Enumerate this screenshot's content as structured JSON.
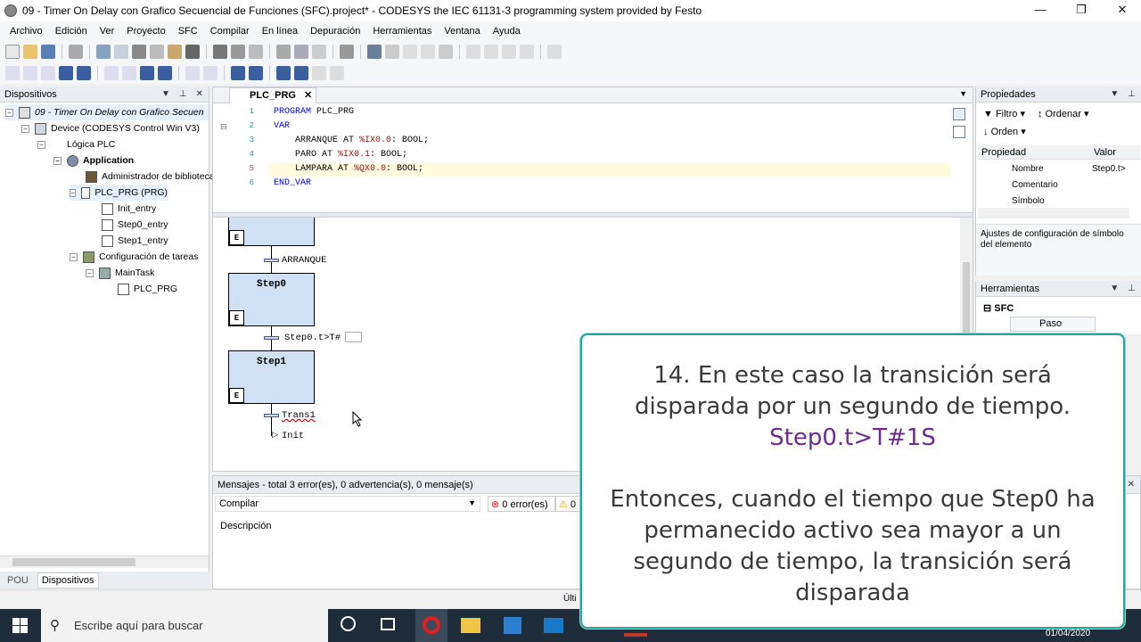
{
  "window": {
    "title": "09 - Timer On Delay con Grafico Secuencial de Funciones (SFC).project* - CODESYS the IEC 61131-3 programming system provided by Festo",
    "minimize": "—",
    "maximize": "❐",
    "close": "✕"
  },
  "menu": [
    "Archivo",
    "Edición",
    "Ver",
    "Proyecto",
    "SFC",
    "Compilar",
    "En línea",
    "Depuración",
    "Herramientas",
    "Ventana",
    "Ayuda"
  ],
  "devices_panel": {
    "title": "Dispositivos",
    "tree": [
      {
        "label": "09 - Timer On Delay con Grafico Secuen"
      },
      {
        "label": "Device (CODESYS Control Win V3)"
      },
      {
        "label": "Lógica PLC"
      },
      {
        "label": "Application"
      },
      {
        "label": "Administrador de biblioteca"
      },
      {
        "label": "PLC_PRG (PRG)"
      },
      {
        "label": "Init_entry"
      },
      {
        "label": "Step0_entry"
      },
      {
        "label": "Step1_entry"
      },
      {
        "label": "Configuración de tareas"
      },
      {
        "label": "MainTask"
      },
      {
        "label": "PLC_PRG"
      }
    ],
    "bottom_tabs": [
      "POU",
      "Dispositivos"
    ]
  },
  "editor": {
    "tab_label": "PLC_PRG",
    "line_numbers": [
      "1",
      "2",
      "3",
      "4",
      "5",
      "6"
    ],
    "code": {
      "l1_kw": "PROGRAM",
      "l1_rest": " PLC_PRG",
      "l2_kw": "VAR",
      "l3_name": "    ARRANQUE AT ",
      "l3_addr": "%IX0.0",
      "l3_type": ": BOOL;",
      "l4_name": "    PARO AT ",
      "l4_addr": "%IX0.1",
      "l4_type": ": BOOL;",
      "l5_name": "    LAMPARA AT ",
      "l5_addr": "%QX0.0",
      "l5_type": ": BOOL;",
      "l6_kw": "END_VAR"
    },
    "sfc": {
      "step_e": "E",
      "transition_1": "ARRANQUE",
      "step0": "Step0",
      "transition_2": "Step0.t>T#",
      "step1": "Step1",
      "transition_3": "Trans1",
      "jump": "Init"
    }
  },
  "properties_panel": {
    "title": "Propiedades",
    "filter": "Filtro",
    "sort": "Ordenar",
    "order": "Orden",
    "col_property": "Propiedad",
    "col_value": "Valor",
    "rows": [
      {
        "name": "Nombre",
        "value": "Step0.t>"
      },
      {
        "name": "Comentario",
        "value": ""
      },
      {
        "name": "Símbolo",
        "value": ""
      }
    ],
    "description": "Ajustes de configuración de símbolo del elemento"
  },
  "tools_panel": {
    "title": "Herramientas",
    "group": "SFC",
    "item": "Paso"
  },
  "messages": {
    "header": "Mensajes - total 3 error(es), 0 advertencia(s), 0 mensaje(s)",
    "source": "Compilar",
    "errors": "0 error(es)",
    "warnings": "0",
    "col_description": "Descripción"
  },
  "status": {
    "last": "Últi"
  },
  "taskbar": {
    "search_placeholder": "Escribe aquí para buscar",
    "date": "01/04/2020"
  },
  "overlay": {
    "line1": "14. En este caso la transición será disparada por un segundo de tiempo.",
    "accent": "Step0.t>T#1S",
    "line2": "Entonces, cuando el tiempo que Step0 ha permanecido activo sea mayor a un segundo de tiempo, la transición será disparada"
  },
  "colors": {
    "overlay_border": "#21a89a",
    "overlay_accent": "#6a2c91",
    "step_fill": "#d2e0f4",
    "taskbar": "#1f2d3a"
  }
}
